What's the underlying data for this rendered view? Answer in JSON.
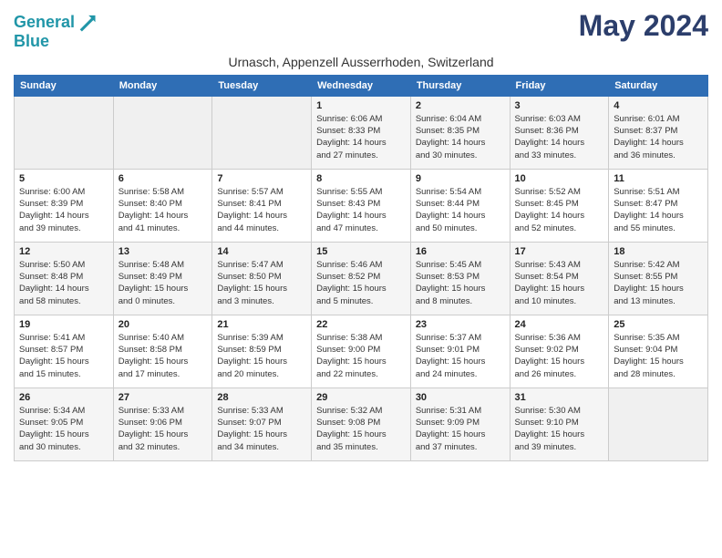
{
  "header": {
    "logo_line1": "General",
    "logo_line2": "Blue",
    "month_title": "May 2024",
    "subtitle": "Urnasch, Appenzell Ausserrhoden, Switzerland"
  },
  "weekdays": [
    "Sunday",
    "Monday",
    "Tuesday",
    "Wednesday",
    "Thursday",
    "Friday",
    "Saturday"
  ],
  "weeks": [
    [
      {
        "day": "",
        "detail": ""
      },
      {
        "day": "",
        "detail": ""
      },
      {
        "day": "",
        "detail": ""
      },
      {
        "day": "1",
        "detail": "Sunrise: 6:06 AM\nSunset: 8:33 PM\nDaylight: 14 hours\nand 27 minutes."
      },
      {
        "day": "2",
        "detail": "Sunrise: 6:04 AM\nSunset: 8:35 PM\nDaylight: 14 hours\nand 30 minutes."
      },
      {
        "day": "3",
        "detail": "Sunrise: 6:03 AM\nSunset: 8:36 PM\nDaylight: 14 hours\nand 33 minutes."
      },
      {
        "day": "4",
        "detail": "Sunrise: 6:01 AM\nSunset: 8:37 PM\nDaylight: 14 hours\nand 36 minutes."
      }
    ],
    [
      {
        "day": "5",
        "detail": "Sunrise: 6:00 AM\nSunset: 8:39 PM\nDaylight: 14 hours\nand 39 minutes."
      },
      {
        "day": "6",
        "detail": "Sunrise: 5:58 AM\nSunset: 8:40 PM\nDaylight: 14 hours\nand 41 minutes."
      },
      {
        "day": "7",
        "detail": "Sunrise: 5:57 AM\nSunset: 8:41 PM\nDaylight: 14 hours\nand 44 minutes."
      },
      {
        "day": "8",
        "detail": "Sunrise: 5:55 AM\nSunset: 8:43 PM\nDaylight: 14 hours\nand 47 minutes."
      },
      {
        "day": "9",
        "detail": "Sunrise: 5:54 AM\nSunset: 8:44 PM\nDaylight: 14 hours\nand 50 minutes."
      },
      {
        "day": "10",
        "detail": "Sunrise: 5:52 AM\nSunset: 8:45 PM\nDaylight: 14 hours\nand 52 minutes."
      },
      {
        "day": "11",
        "detail": "Sunrise: 5:51 AM\nSunset: 8:47 PM\nDaylight: 14 hours\nand 55 minutes."
      }
    ],
    [
      {
        "day": "12",
        "detail": "Sunrise: 5:50 AM\nSunset: 8:48 PM\nDaylight: 14 hours\nand 58 minutes."
      },
      {
        "day": "13",
        "detail": "Sunrise: 5:48 AM\nSunset: 8:49 PM\nDaylight: 15 hours\nand 0 minutes."
      },
      {
        "day": "14",
        "detail": "Sunrise: 5:47 AM\nSunset: 8:50 PM\nDaylight: 15 hours\nand 3 minutes."
      },
      {
        "day": "15",
        "detail": "Sunrise: 5:46 AM\nSunset: 8:52 PM\nDaylight: 15 hours\nand 5 minutes."
      },
      {
        "day": "16",
        "detail": "Sunrise: 5:45 AM\nSunset: 8:53 PM\nDaylight: 15 hours\nand 8 minutes."
      },
      {
        "day": "17",
        "detail": "Sunrise: 5:43 AM\nSunset: 8:54 PM\nDaylight: 15 hours\nand 10 minutes."
      },
      {
        "day": "18",
        "detail": "Sunrise: 5:42 AM\nSunset: 8:55 PM\nDaylight: 15 hours\nand 13 minutes."
      }
    ],
    [
      {
        "day": "19",
        "detail": "Sunrise: 5:41 AM\nSunset: 8:57 PM\nDaylight: 15 hours\nand 15 minutes."
      },
      {
        "day": "20",
        "detail": "Sunrise: 5:40 AM\nSunset: 8:58 PM\nDaylight: 15 hours\nand 17 minutes."
      },
      {
        "day": "21",
        "detail": "Sunrise: 5:39 AM\nSunset: 8:59 PM\nDaylight: 15 hours\nand 20 minutes."
      },
      {
        "day": "22",
        "detail": "Sunrise: 5:38 AM\nSunset: 9:00 PM\nDaylight: 15 hours\nand 22 minutes."
      },
      {
        "day": "23",
        "detail": "Sunrise: 5:37 AM\nSunset: 9:01 PM\nDaylight: 15 hours\nand 24 minutes."
      },
      {
        "day": "24",
        "detail": "Sunrise: 5:36 AM\nSunset: 9:02 PM\nDaylight: 15 hours\nand 26 minutes."
      },
      {
        "day": "25",
        "detail": "Sunrise: 5:35 AM\nSunset: 9:04 PM\nDaylight: 15 hours\nand 28 minutes."
      }
    ],
    [
      {
        "day": "26",
        "detail": "Sunrise: 5:34 AM\nSunset: 9:05 PM\nDaylight: 15 hours\nand 30 minutes."
      },
      {
        "day": "27",
        "detail": "Sunrise: 5:33 AM\nSunset: 9:06 PM\nDaylight: 15 hours\nand 32 minutes."
      },
      {
        "day": "28",
        "detail": "Sunrise: 5:33 AM\nSunset: 9:07 PM\nDaylight: 15 hours\nand 34 minutes."
      },
      {
        "day": "29",
        "detail": "Sunrise: 5:32 AM\nSunset: 9:08 PM\nDaylight: 15 hours\nand 35 minutes."
      },
      {
        "day": "30",
        "detail": "Sunrise: 5:31 AM\nSunset: 9:09 PM\nDaylight: 15 hours\nand 37 minutes."
      },
      {
        "day": "31",
        "detail": "Sunrise: 5:30 AM\nSunset: 9:10 PM\nDaylight: 15 hours\nand 39 minutes."
      },
      {
        "day": "",
        "detail": ""
      }
    ]
  ]
}
